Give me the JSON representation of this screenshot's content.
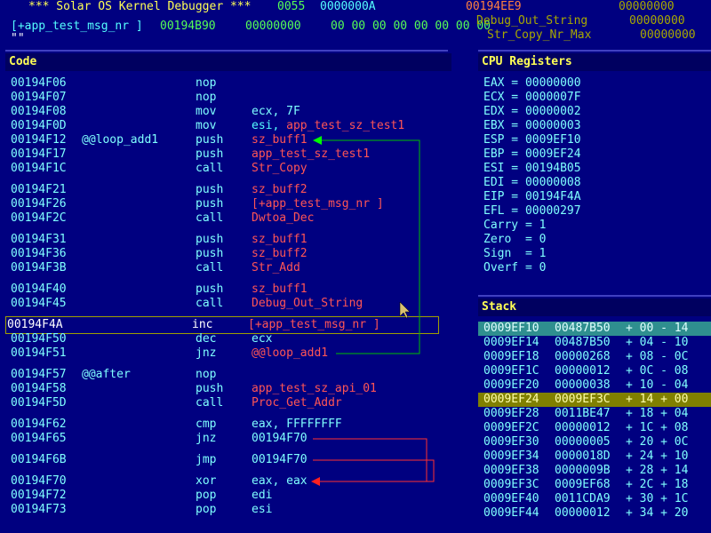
{
  "header": {
    "title": "*** Solar OS Kernel Debugger ***",
    "counter": "0055",
    "value1": "0000000A",
    "value2": "00194EE9",
    "value3": "00000000",
    "watch_name": "[+app_test_msg_nr ]",
    "watch_addr": "00194B90",
    "watch_value": "00000000",
    "watch_bytes": "00 00 00 00 00 00 00 00",
    "sym1_name": "Debug_Out_String",
    "sym1_value": "00000000",
    "sym2_name": "Str_Copy_Nr_Max",
    "sym2_value": "00000000",
    "string_preview": "\"\""
  },
  "code": {
    "title": "Code",
    "rows": [
      {
        "addr": "00194F06",
        "label": "",
        "mn": "nop",
        "op": ""
      },
      {
        "addr": "00194F07",
        "label": "",
        "mn": "nop",
        "op": ""
      },
      {
        "addr": "00194F08",
        "label": "",
        "mn": "mov",
        "op": "ecx, 7F"
      },
      {
        "addr": "00194F0D",
        "label": "",
        "mn": "mov",
        "op": "esi, app_test_sz_test1"
      },
      {
        "addr": "00194F12",
        "label": "@@loop_add1",
        "mn": "push",
        "op": "sz_buff1"
      },
      {
        "addr": "00194F17",
        "label": "",
        "mn": "push",
        "op": "app_test_sz_test1"
      },
      {
        "addr": "00194F1C",
        "label": "",
        "mn": "call",
        "op": "Str_Copy"
      },
      {
        "addr": "00194F21",
        "label": "",
        "mn": "push",
        "op": "sz_buff2"
      },
      {
        "addr": "00194F26",
        "label": "",
        "mn": "push",
        "op": "[+app_test_msg_nr ]"
      },
      {
        "addr": "00194F2C",
        "label": "",
        "mn": "call",
        "op": "Dwtoa_Dec"
      },
      {
        "addr": "00194F31",
        "label": "",
        "mn": "push",
        "op": "sz_buff1"
      },
      {
        "addr": "00194F36",
        "label": "",
        "mn": "push",
        "op": "sz_buff2"
      },
      {
        "addr": "00194F3B",
        "label": "",
        "mn": "call",
        "op": "Str_Add"
      },
      {
        "addr": "00194F40",
        "label": "",
        "mn": "push",
        "op": "sz_buff1"
      },
      {
        "addr": "00194F45",
        "label": "",
        "mn": "call",
        "op": "Debug_Out_String"
      },
      {
        "addr": "00194F4A",
        "label": "",
        "mn": "inc",
        "op": "[+app_test_msg_nr ]"
      },
      {
        "addr": "00194F50",
        "label": "",
        "mn": "dec",
        "op": "ecx"
      },
      {
        "addr": "00194F51",
        "label": "",
        "mn": "jnz",
        "op": "@@loop_add1"
      },
      {
        "addr": "00194F57",
        "label": "@@after",
        "mn": "nop",
        "op": ""
      },
      {
        "addr": "00194F58",
        "label": "",
        "mn": "push",
        "op": "app_test_sz_api_01"
      },
      {
        "addr": "00194F5D",
        "label": "",
        "mn": "call",
        "op": "Proc_Get_Addr"
      },
      {
        "addr": "00194F62",
        "label": "",
        "mn": "cmp",
        "op": "eax, FFFFFFFF"
      },
      {
        "addr": "00194F65",
        "label": "",
        "mn": "jnz",
        "op": "00194F70"
      },
      {
        "addr": "00194F6B",
        "label": "",
        "mn": "jmp",
        "op": "00194F70"
      },
      {
        "addr": "00194F70",
        "label": "",
        "mn": "xor",
        "op": "eax, eax"
      },
      {
        "addr": "00194F72",
        "label": "",
        "mn": "pop",
        "op": "edi"
      },
      {
        "addr": "00194F73",
        "label": "",
        "mn": "pop",
        "op": "esi"
      }
    ]
  },
  "cpu": {
    "title": "CPU Registers",
    "rows": [
      "EAX = 00000000",
      "ECX = 0000007F",
      "EDX = 00000002",
      "EBX = 00000003",
      "ESP = 0009EF10",
      "EBP = 0009EF24",
      "ESI = 00194B05",
      "EDI = 00000008",
      "EIP = 00194F4A",
      "EFL = 00000297",
      "Carry = 1",
      "Zero  = 0",
      "Sign  = 1",
      "Overf = 0"
    ]
  },
  "stack": {
    "title": "Stack",
    "rows": [
      {
        "addr": "0009EF10",
        "val": "00487B50",
        "off": "+ 00 - 14"
      },
      {
        "addr": "0009EF14",
        "val": "00487B50",
        "off": "+ 04 - 10"
      },
      {
        "addr": "0009EF18",
        "val": "00000268",
        "off": "+ 08 - 0C"
      },
      {
        "addr": "0009EF1C",
        "val": "00000012",
        "off": "+ 0C - 08"
      },
      {
        "addr": "0009EF20",
        "val": "00000038",
        "off": "+ 10 - 04"
      },
      {
        "addr": "0009EF24",
        "val": "0009EF3C",
        "off": "+ 14 + 00"
      },
      {
        "addr": "0009EF28",
        "val": "0011BE47",
        "off": "+ 18 + 04"
      },
      {
        "addr": "0009EF2C",
        "val": "00000012",
        "off": "+ 1C + 08"
      },
      {
        "addr": "0009EF30",
        "val": "00000005",
        "off": "+ 20 + 0C"
      },
      {
        "addr": "0009EF34",
        "val": "0000018D",
        "off": "+ 24 + 10"
      },
      {
        "addr": "0009EF38",
        "val": "0000009B",
        "off": "+ 28 + 14"
      },
      {
        "addr": "0009EF3C",
        "val": "0009EF68",
        "off": "+ 2C + 18"
      },
      {
        "addr": "0009EF40",
        "val": "0011CDA9",
        "off": "+ 30 + 1C"
      },
      {
        "addr": "0009EF44",
        "val": "00000012",
        "off": "+ 34 + 20"
      }
    ]
  },
  "colors": {
    "background": "#000080",
    "esp_highlight": "#2f8f8f",
    "ebp_highlight": "#808000",
    "loop_arrow": "#00c000",
    "jump_arrow": "#ff3030"
  }
}
